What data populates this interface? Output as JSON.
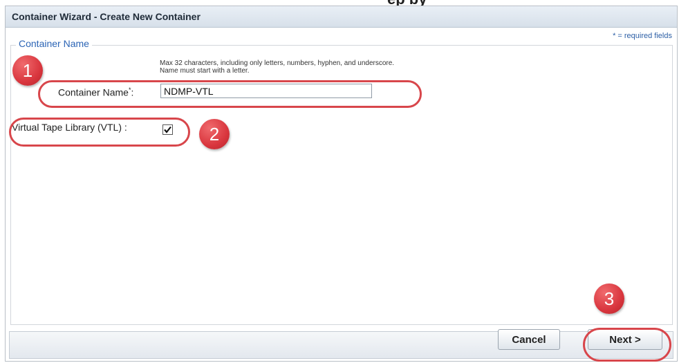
{
  "top_fragment": "ep by",
  "window": {
    "title": "Container Wizard - Create New Container",
    "required_note": "* = required fields"
  },
  "section": {
    "legend": "Container Name",
    "hint": "Max 32 characters, including only letters, numbers, hyphen, and underscore. Name must start with a letter."
  },
  "fields": {
    "container_name_label": "Container Name",
    "container_name_required_mark": "*",
    "container_name_colon": ":",
    "container_name_value": "NDMP-VTL",
    "vtl_label": "Virtual Tape Library (VTL) :",
    "vtl_checked": true
  },
  "buttons": {
    "cancel": "Cancel",
    "next": "Next >"
  },
  "callouts": {
    "one": "1",
    "two": "2",
    "three": "3",
    "color": "#d8464b"
  },
  "icons": {
    "checkbox": "checkmark-icon"
  }
}
